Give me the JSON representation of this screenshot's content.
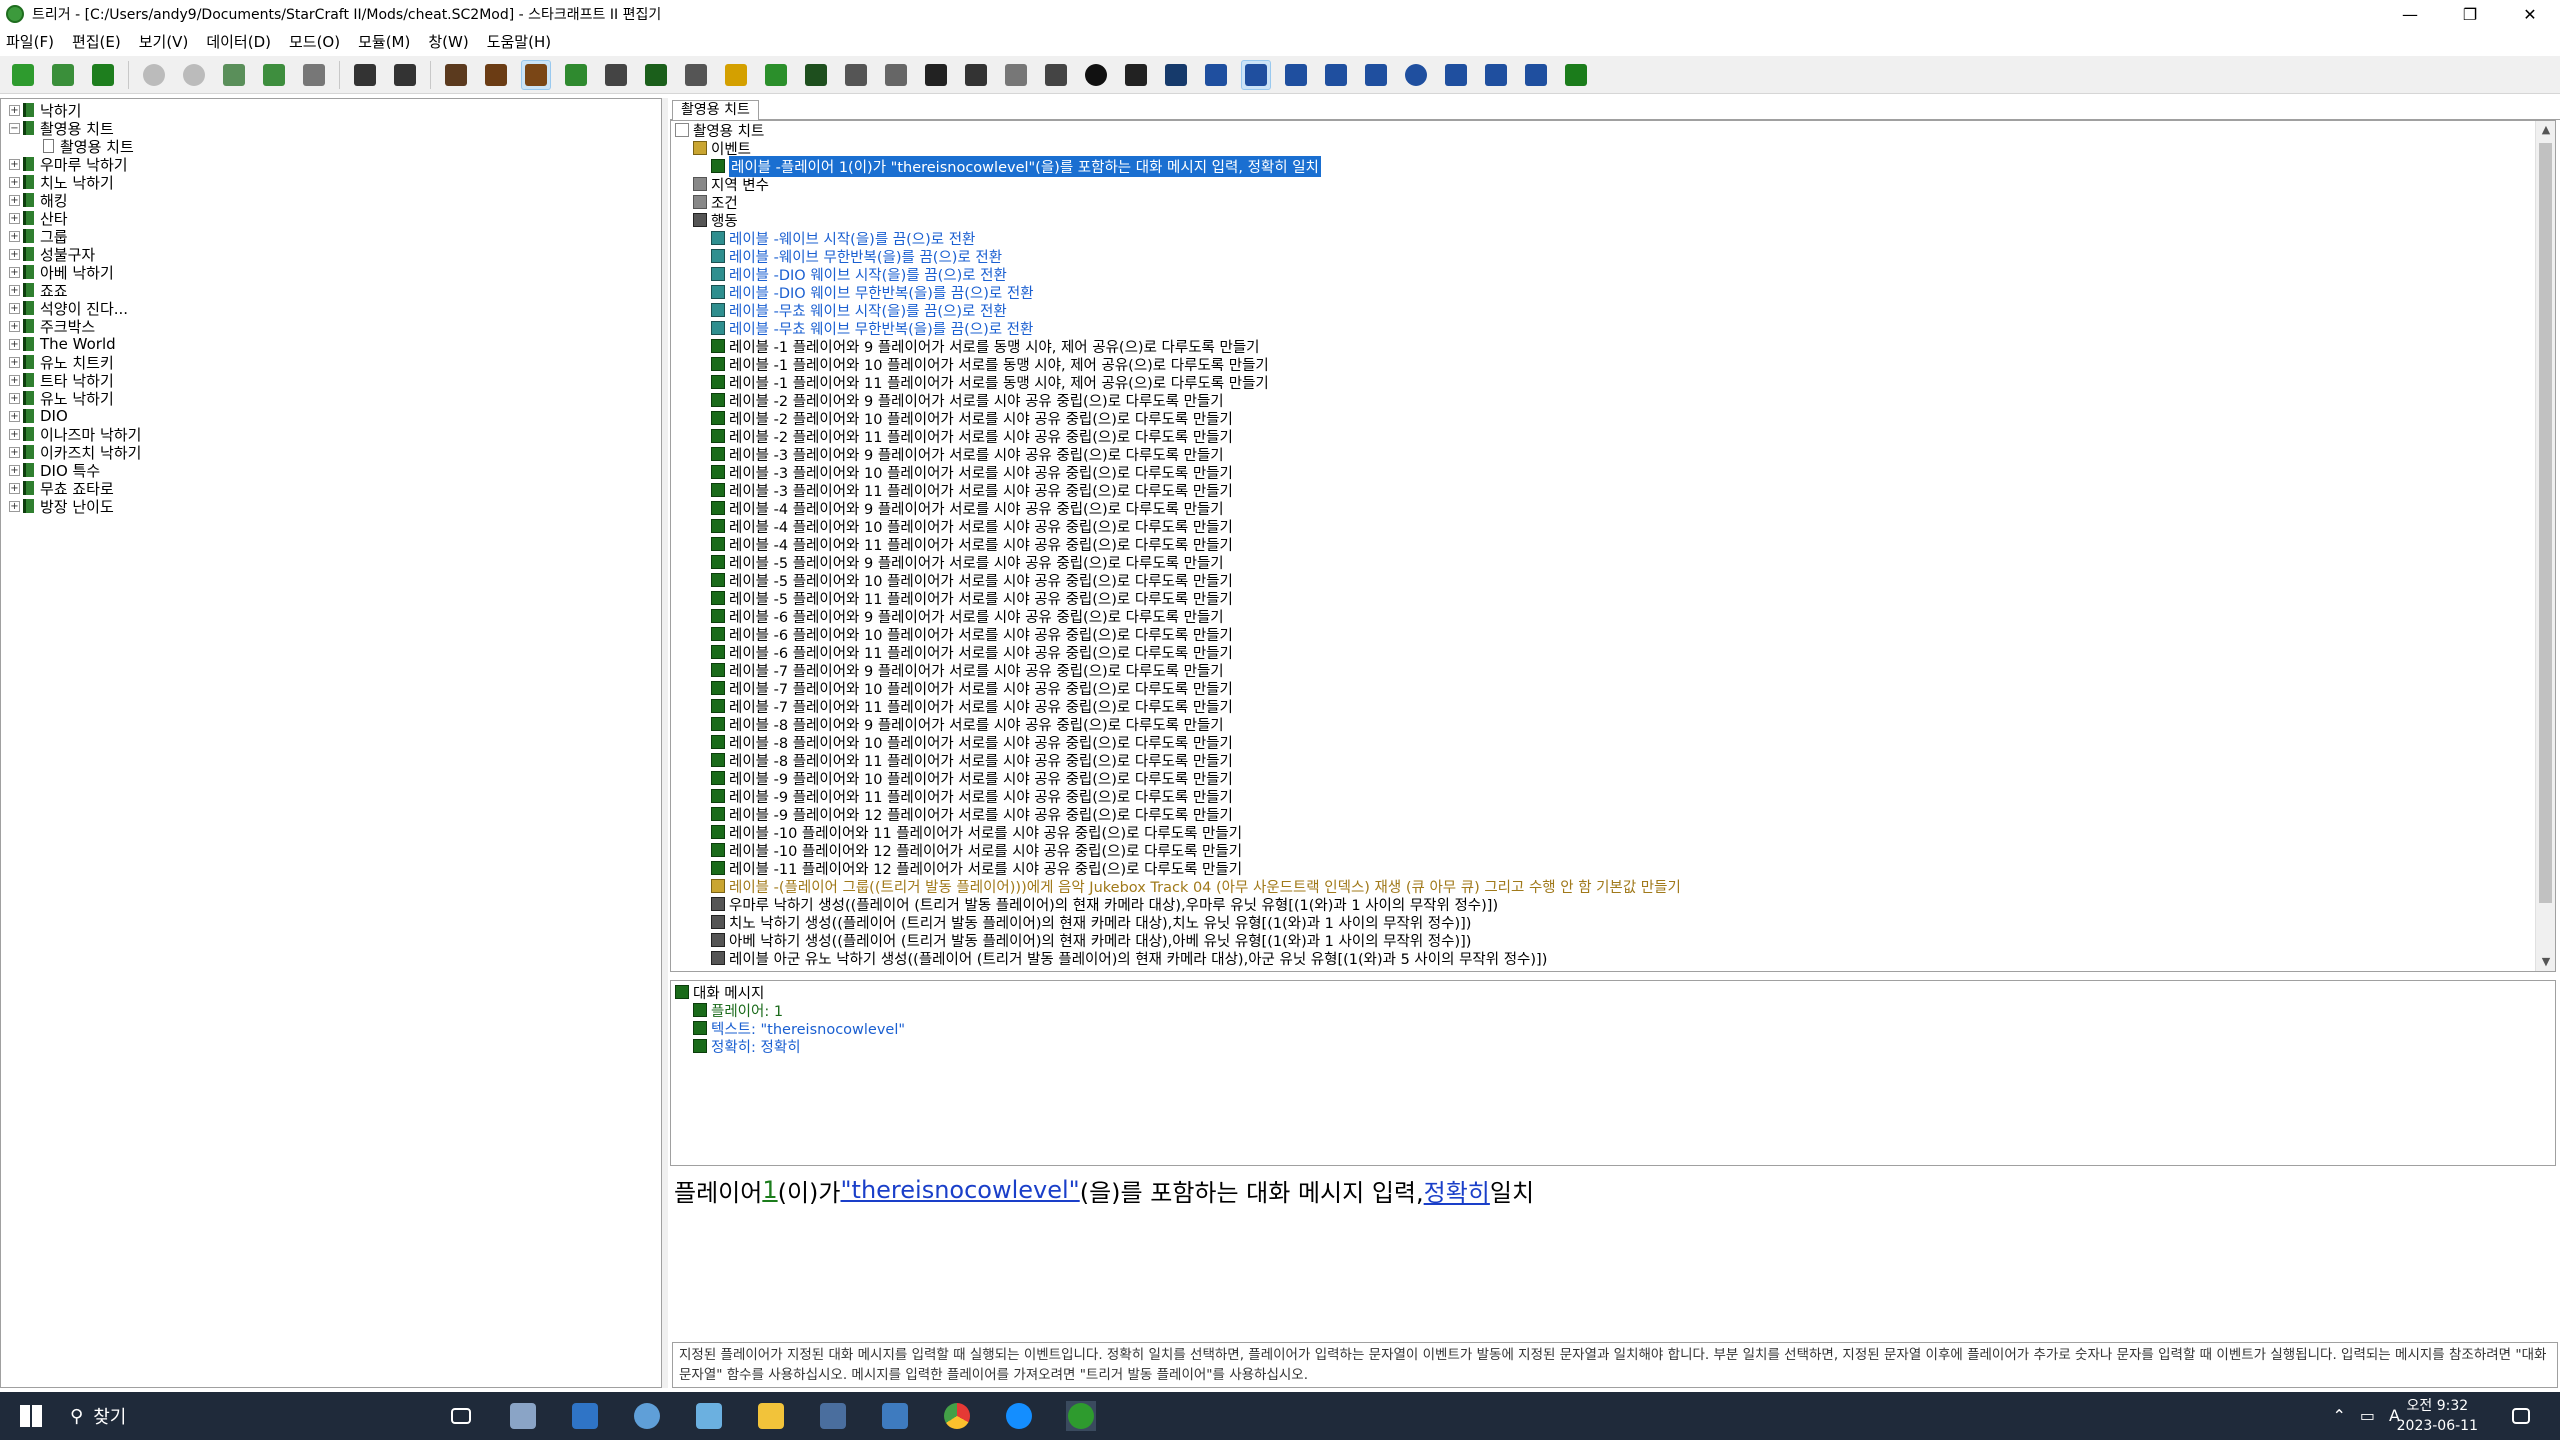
{
  "window": {
    "title": "트리거 - [C:/Users/andy9/Documents/StarCraft II/Mods/cheat.SC2Mod] - 스타크래프트 II 편집기"
  },
  "menu": [
    "파일(F)",
    "편집(E)",
    "보기(V)",
    "데이터(D)",
    "모드(O)",
    "모듈(M)",
    "창(W)",
    "도움말(H)"
  ],
  "left_tree": [
    {
      "label": "낙하기",
      "level": 0
    },
    {
      "label": "촬영용 치트",
      "level": 0,
      "expanded": true
    },
    {
      "label": "촬영용 치트",
      "level": 1
    },
    {
      "label": "우마루 낙하기",
      "level": 0
    },
    {
      "label": "치노 낙하기",
      "level": 0
    },
    {
      "label": "해킹",
      "level": 0
    },
    {
      "label": "산타",
      "level": 0
    },
    {
      "label": "그룹",
      "level": 0
    },
    {
      "label": "성불구자",
      "level": 0
    },
    {
      "label": "아베 낙하기",
      "level": 0
    },
    {
      "label": "죠죠",
      "level": 0
    },
    {
      "label": "석양이 진다...",
      "level": 0
    },
    {
      "label": "주크박스",
      "level": 0
    },
    {
      "label": "The World",
      "level": 0
    },
    {
      "label": "유노 치트키",
      "level": 0
    },
    {
      "label": "트타 낙하기",
      "level": 0
    },
    {
      "label": "유노 낙하기",
      "level": 0
    },
    {
      "label": "DIO",
      "level": 0
    },
    {
      "label": "이나즈마 낙하기",
      "level": 0
    },
    {
      "label": "이카즈치 낙하기",
      "level": 0
    },
    {
      "label": "DIO 특수",
      "level": 0
    },
    {
      "label": "무쵸 죠타로",
      "level": 0
    },
    {
      "label": "방장 난이도",
      "level": 0
    }
  ],
  "tab": {
    "label": "촬영용 치트"
  },
  "main_tree": {
    "root": "촬영용 치트",
    "event_label": "이벤트",
    "event_item": "레이블 -플레이어 1(이)가 \"thereisnocowlevel\"(을)를 포함하는 대화 메시지 입력, 정확히 일치",
    "local_vars": "지역 변수",
    "conditions": "조건",
    "actions_label": "행동",
    "actions": [
      {
        "text": "레이블 -웨이브 시작(을)를 끔(으)로 전환",
        "style": "blue",
        "icon": "b"
      },
      {
        "text": "레이블 -웨이브 무한반복(을)를 끔(으)로 전환",
        "style": "blue",
        "icon": "b"
      },
      {
        "text": "레이블 -DIO 웨이브 시작(을)를 끔(으)로 전환",
        "style": "blue",
        "icon": "b"
      },
      {
        "text": "레이블 -DIO 웨이브 무한반복(을)를 끔(으)로 전환",
        "style": "blue",
        "icon": "b"
      },
      {
        "text": "레이블 -무쵸 웨이브 시작(을)를 끔(으)로 전환",
        "style": "blue",
        "icon": "b"
      },
      {
        "text": "레이블 -무쵸 웨이브 무한반복(을)를 끔(으)로 전환",
        "style": "blue",
        "icon": "b"
      },
      {
        "text": "레이블 -1 플레이어와 9 플레이어가 서로를 동맹 시야, 제어 공유(으)로 다루도록 만들기",
        "style": "",
        "icon": "a"
      },
      {
        "text": "레이블 -1 플레이어와 10 플레이어가 서로를 동맹 시야, 제어 공유(으)로 다루도록 만들기",
        "style": "",
        "icon": "a"
      },
      {
        "text": "레이블 -1 플레이어와 11 플레이어가 서로를 동맹 시야, 제어 공유(으)로 다루도록 만들기",
        "style": "",
        "icon": "a"
      },
      {
        "text": "레이블 -2 플레이어와 9 플레이어가 서로를 시야 공유 중립(으)로 다루도록 만들기",
        "style": "",
        "icon": "a"
      },
      {
        "text": "레이블 -2 플레이어와 10 플레이어가 서로를 시야 공유 중립(으)로 다루도록 만들기",
        "style": "",
        "icon": "a"
      },
      {
        "text": "레이블 -2 플레이어와 11 플레이어가 서로를 시야 공유 중립(으)로 다루도록 만들기",
        "style": "",
        "icon": "a"
      },
      {
        "text": "레이블 -3 플레이어와 9 플레이어가 서로를 시야 공유 중립(으)로 다루도록 만들기",
        "style": "",
        "icon": "a"
      },
      {
        "text": "레이블 -3 플레이어와 10 플레이어가 서로를 시야 공유 중립(으)로 다루도록 만들기",
        "style": "",
        "icon": "a"
      },
      {
        "text": "레이블 -3 플레이어와 11 플레이어가 서로를 시야 공유 중립(으)로 다루도록 만들기",
        "style": "",
        "icon": "a"
      },
      {
        "text": "레이블 -4 플레이어와 9 플레이어가 서로를 시야 공유 중립(으)로 다루도록 만들기",
        "style": "",
        "icon": "a"
      },
      {
        "text": "레이블 -4 플레이어와 10 플레이어가 서로를 시야 공유 중립(으)로 다루도록 만들기",
        "style": "",
        "icon": "a"
      },
      {
        "text": "레이블 -4 플레이어와 11 플레이어가 서로를 시야 공유 중립(으)로 다루도록 만들기",
        "style": "",
        "icon": "a"
      },
      {
        "text": "레이블 -5 플레이어와 9 플레이어가 서로를 시야 공유 중립(으)로 다루도록 만들기",
        "style": "",
        "icon": "a"
      },
      {
        "text": "레이블 -5 플레이어와 10 플레이어가 서로를 시야 공유 중립(으)로 다루도록 만들기",
        "style": "",
        "icon": "a"
      },
      {
        "text": "레이블 -5 플레이어와 11 플레이어가 서로를 시야 공유 중립(으)로 다루도록 만들기",
        "style": "",
        "icon": "a"
      },
      {
        "text": "레이블 -6 플레이어와 9 플레이어가 서로를 시야 공유 중립(으)로 다루도록 만들기",
        "style": "",
        "icon": "a"
      },
      {
        "text": "레이블 -6 플레이어와 10 플레이어가 서로를 시야 공유 중립(으)로 다루도록 만들기",
        "style": "",
        "icon": "a"
      },
      {
        "text": "레이블 -6 플레이어와 11 플레이어가 서로를 시야 공유 중립(으)로 다루도록 만들기",
        "style": "",
        "icon": "a"
      },
      {
        "text": "레이블 -7 플레이어와 9 플레이어가 서로를 시야 공유 중립(으)로 다루도록 만들기",
        "style": "",
        "icon": "a"
      },
      {
        "text": "레이블 -7 플레이어와 10 플레이어가 서로를 시야 공유 중립(으)로 다루도록 만들기",
        "style": "",
        "icon": "a"
      },
      {
        "text": "레이블 -7 플레이어와 11 플레이어가 서로를 시야 공유 중립(으)로 다루도록 만들기",
        "style": "",
        "icon": "a"
      },
      {
        "text": "레이블 -8 플레이어와 9 플레이어가 서로를 시야 공유 중립(으)로 다루도록 만들기",
        "style": "",
        "icon": "a"
      },
      {
        "text": "레이블 -8 플레이어와 10 플레이어가 서로를 시야 공유 중립(으)로 다루도록 만들기",
        "style": "",
        "icon": "a"
      },
      {
        "text": "레이블 -8 플레이어와 11 플레이어가 서로를 시야 공유 중립(으)로 다루도록 만들기",
        "style": "",
        "icon": "a"
      },
      {
        "text": "레이블 -9 플레이어와 10 플레이어가 서로를 시야 공유 중립(으)로 다루도록 만들기",
        "style": "",
        "icon": "a"
      },
      {
        "text": "레이블 -9 플레이어와 11 플레이어가 서로를 시야 공유 중립(으)로 다루도록 만들기",
        "style": "",
        "icon": "a"
      },
      {
        "text": "레이블 -9 플레이어와 12 플레이어가 서로를 시야 공유 중립(으)로 다루도록 만들기",
        "style": "",
        "icon": "a"
      },
      {
        "text": "레이블 -10 플레이어와 11 플레이어가 서로를 시야 공유 중립(으)로 다루도록 만들기",
        "style": "",
        "icon": "a"
      },
      {
        "text": "레이블 -10 플레이어와 12 플레이어가 서로를 시야 공유 중립(으)로 다루도록 만들기",
        "style": "",
        "icon": "a"
      },
      {
        "text": "레이블 -11 플레이어와 12 플레이어가 서로를 시야 공유 중립(으)로 다루도록 만들기",
        "style": "",
        "icon": "a"
      },
      {
        "text": "레이블 -(플레이어 그룹((트리거 발동 플레이어)))에게 음악 Jukebox Track 04 (아무 사운드트랙 인덱스) 재생 (큐 아무 큐) 그리고 수행 안 함 기본값 만들기",
        "style": "gold",
        "icon": "c"
      },
      {
        "text": "우마루 낙하기 생성((플레이어 (트리거 발동 플레이어)의 현재 카메라 대상),우마루 유닛 유형[(1(와)과 1 사이의 무작위 정수)])",
        "style": "",
        "icon": "d"
      },
      {
        "text": "치노 낙하기 생성((플레이어 (트리거 발동 플레이어)의 현재 카메라 대상),치노 유닛 유형[(1(와)과 1 사이의 무작위 정수)])",
        "style": "",
        "icon": "d"
      },
      {
        "text": "아베 낙하기 생성((플레이어 (트리거 발동 플레이어)의 현재 카메라 대상),아베 유닛 유형[(1(와)과 1 사이의 무작위 정수)])",
        "style": "",
        "icon": "d"
      },
      {
        "text": "레이블 아군 유노 낙하기 생성((플레이어 (트리거 발동 플레이어)의 현재 카메라 대상),아군 유닛 유형[(1(와)과 5 사이의 무작위 정수)])",
        "style": "",
        "icon": "d"
      }
    ]
  },
  "param_tree": {
    "root": "대화 메시지",
    "items": [
      {
        "text": "플레이어: 1",
        "style": "num"
      },
      {
        "text": "텍스트: \"thereisnocowlevel\"",
        "style": "blue"
      },
      {
        "text": "정확히: 정확히",
        "style": "blue"
      }
    ]
  },
  "sentence": {
    "p1": "플레이어 ",
    "num": "1",
    "p2": "(이)가 ",
    "text": "\"thereisnocowlevel\"",
    "p3": "(을)를 포함하는 대화 메시지 입력, ",
    "exact": "정확히",
    "p4": " 일치"
  },
  "description": "지정된 플레이어가 지정된 대화 메시지를 입력할 때 실행되는 이벤트입니다. 정확히 일치를 선택하면, 플레이어가 입력하는 문자열이 이벤트가 발동에 지정된 문자열과 일치해야 합니다. 부분 일치를 선택하면, 지정된 문자열 이후에 플레이어가 추가로 숫자나 문자를 입력할 때 이벤트가 실행됩니다. 입력되는 메시지를 참조하려면 \"대화 문자열\" 함수를 사용하십시오. 메시지를 입력한 플레이어를 가져오려면 \"트리거 발동 플레이어\"를 사용하십시오.",
  "taskbar": {
    "search_placeholder": "찾기",
    "time": "오전 9:32",
    "date": "2023-06-11",
    "ime": "A"
  },
  "colors": {
    "accent": "#1a6fd1",
    "taskbar": "#1f2a3a",
    "tree_green": "#1a6b1a"
  }
}
